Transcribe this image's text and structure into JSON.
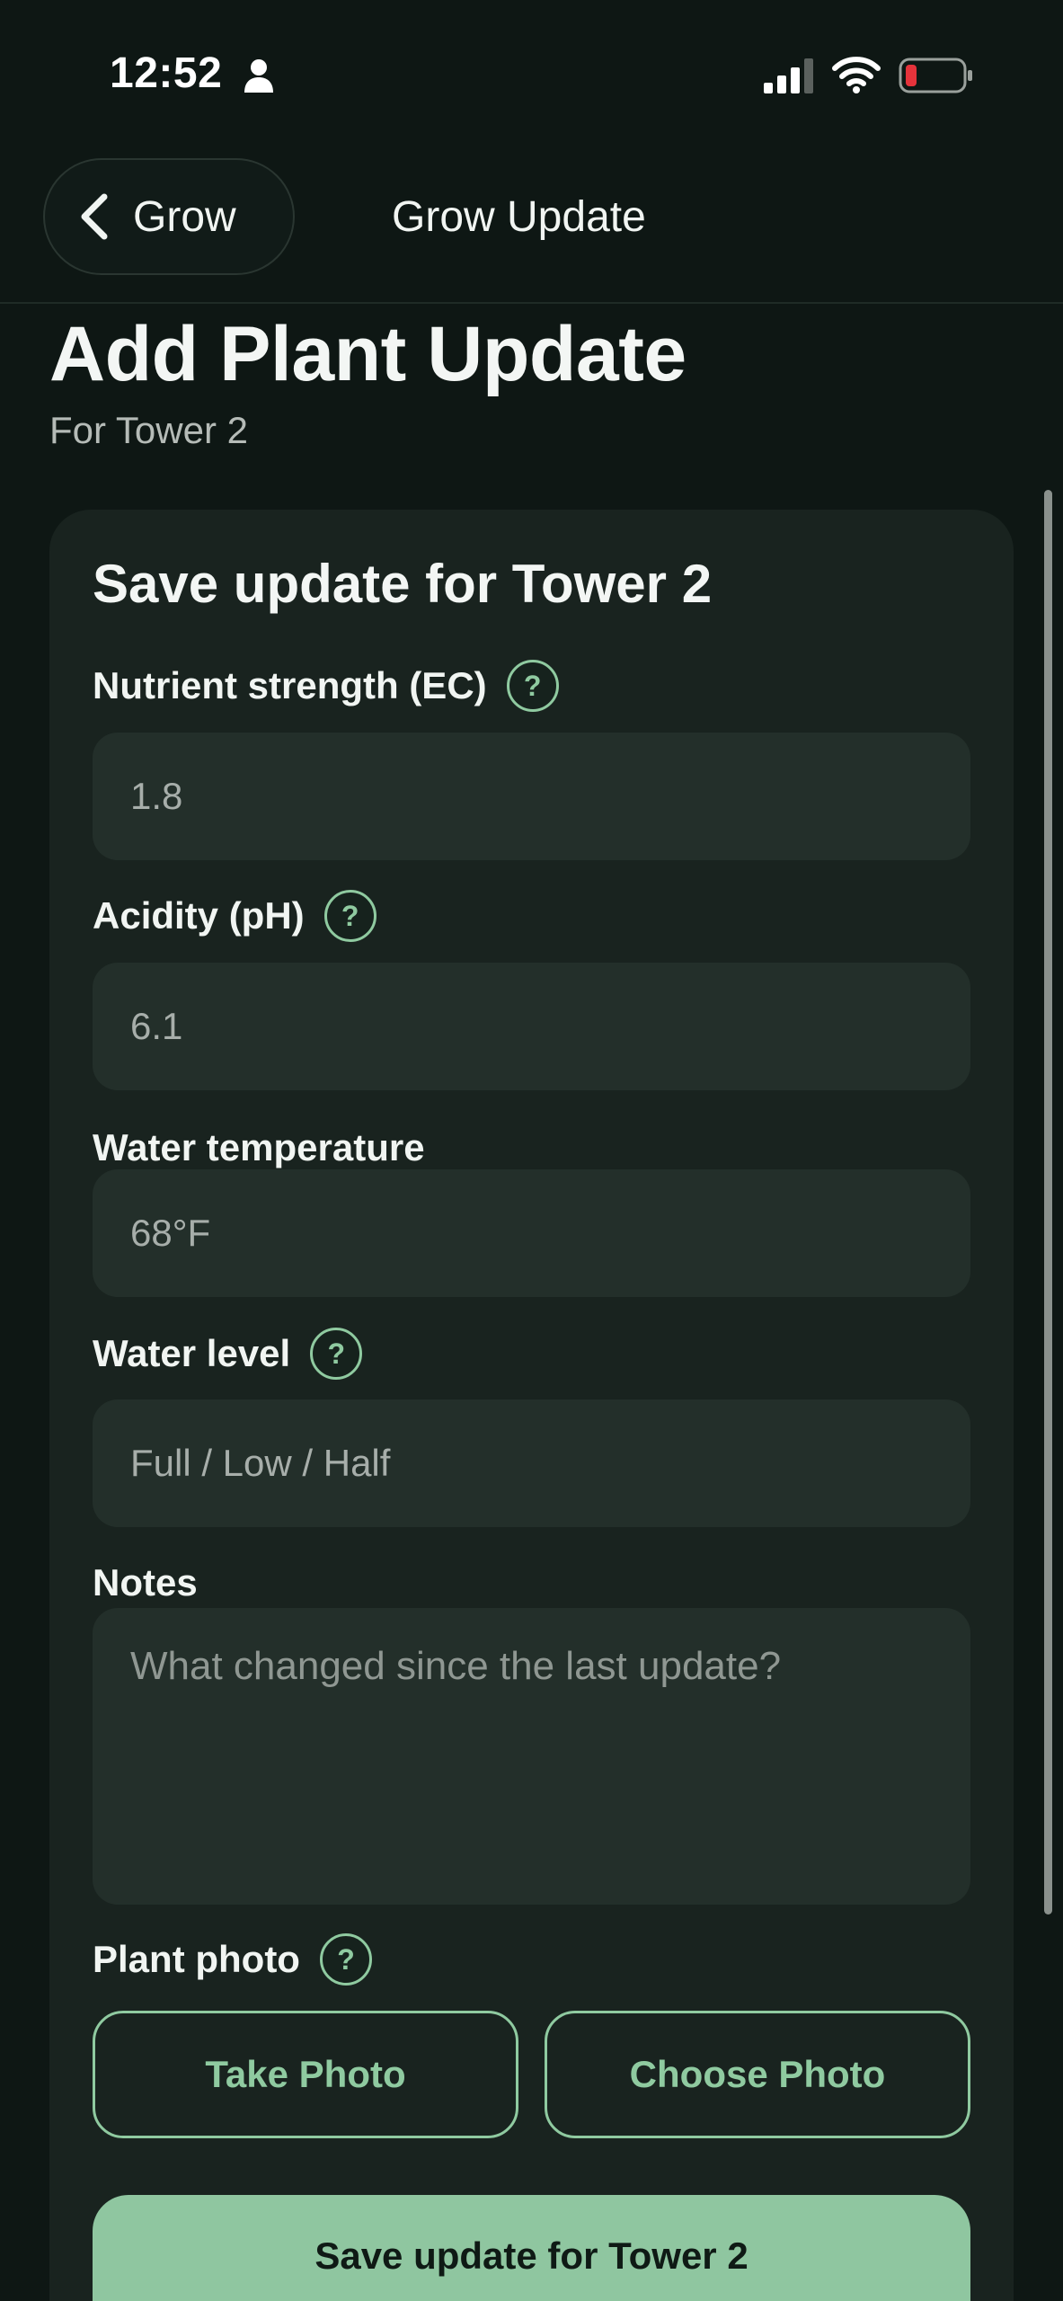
{
  "status_bar": {
    "time": "12:52"
  },
  "nav": {
    "back_label": "Grow",
    "title": "Grow Update"
  },
  "header": {
    "title": "Add Plant Update",
    "subtitle": "For Tower 2"
  },
  "form": {
    "card_title": "Save update for Tower 2",
    "fields": [
      {
        "label": "Nutrient strength (EC)",
        "value": "1.8",
        "has_help": true
      },
      {
        "label": "Acidity (pH)",
        "value": "6.1",
        "has_help": true
      },
      {
        "label": "Water temperature",
        "value": "68°F",
        "has_help": false
      },
      {
        "label": "Water level",
        "placeholder": "Full / Low / Half",
        "has_help": true
      }
    ],
    "notes": {
      "label": "Notes",
      "placeholder": "What changed since the last update?"
    },
    "photo": {
      "label": "Plant photo",
      "take_label": "Take Photo",
      "choose_label": "Choose Photo"
    },
    "help_glyph": "?",
    "save_label": "Save update for Tower 2"
  },
  "colors": {
    "background": "#0e1714",
    "card": "#19231f",
    "field": "#232f2a",
    "accent": "#8fcaa0",
    "save_button": "#8fc6a0",
    "battery_low": "#e5333b"
  },
  "icons": {
    "person": "person-icon",
    "signal": "signal-icon",
    "wifi": "wifi-icon",
    "battery": "battery-low-icon",
    "back": "chevron-left-icon",
    "help": "question-mark-icon"
  }
}
